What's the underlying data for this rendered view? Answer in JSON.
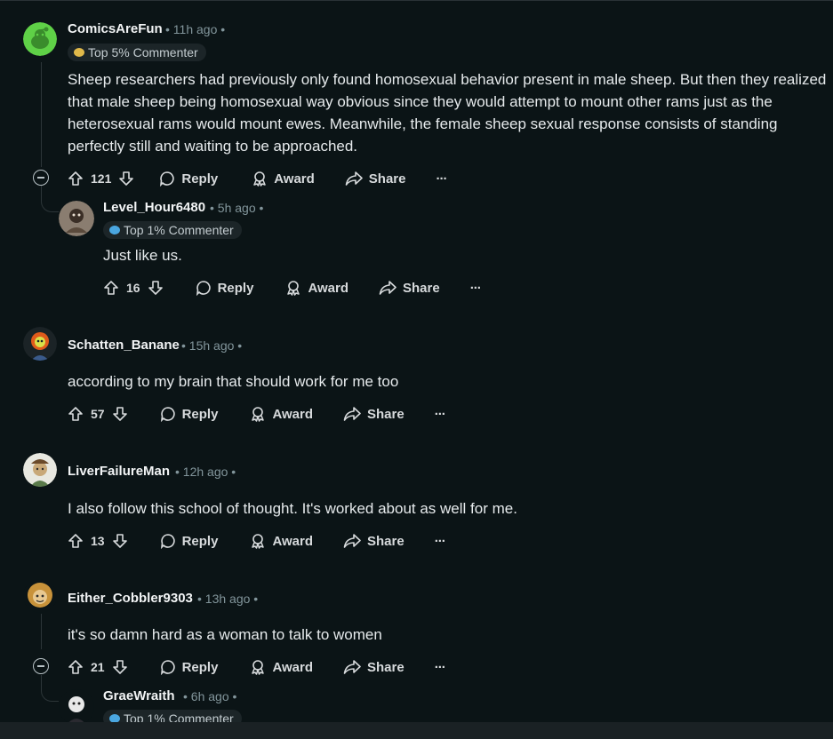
{
  "comments": [
    {
      "username": "ComicsAreFun",
      "time": "11h ago",
      "badge": "Top 5% Commenter",
      "body": "Sheep researchers had previously only found homosexual behavior present in male sheep. But then they realized that male sheep being homosexual way obvious since they would attempt to mount other rams just as the heterosexual rams would mount ewes. Meanwhile, the female sheep sexual response consists of standing perfectly still and waiting to be approached.",
      "votes": "121",
      "avatar_icon": "reddit-snoo-green-icon"
    },
    {
      "username": "Level_Hour6480",
      "time": "5h ago",
      "badge": "Top 1% Commenter",
      "body": "Just like us.",
      "votes": "16",
      "avatar_icon": "user-photo-avatar"
    },
    {
      "username": "Schatten_Banane",
      "time": "15h ago",
      "body": "according to my brain that should work for me too",
      "votes": "57",
      "avatar_icon": "snoo-avatar-orange"
    },
    {
      "username": "LiverFailureMan",
      "time": "12h ago",
      "body": "I also follow this school of thought. It's worked about as well for me.",
      "votes": "13",
      "avatar_icon": "snoo-avatar-hat"
    },
    {
      "username": "Either_Cobbler9303",
      "time": "13h ago",
      "body": "it's so damn hard as a woman to talk to women",
      "votes": "21",
      "avatar_icon": "snoo-avatar-curly-hair"
    },
    {
      "username": "GraeWraith",
      "time": "6h ago",
      "badge": "Top 1% Commenter",
      "avatar_icon": "snoo-avatar-dark"
    }
  ],
  "actions": {
    "reply": "Reply",
    "award": "Award",
    "share": "Share",
    "more": "···"
  },
  "meta_dot": "•",
  "colors": {
    "background": "#0b1416",
    "text": "#f2f4f5",
    "muted": "#82959b",
    "badge_bg": "#1c2528",
    "snoo_green": "#5fd147"
  }
}
